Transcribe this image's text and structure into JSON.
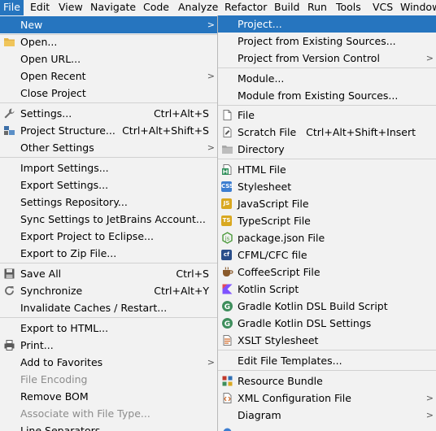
{
  "menubar": [
    "File",
    "Edit",
    "View",
    "Navigate",
    "Code",
    "Analyze",
    "Refactor",
    "Build",
    "Run",
    "Tools",
    "VCS",
    "Window"
  ],
  "file_menu": {
    "new": "New",
    "open": "Open...",
    "open_url": "Open URL...",
    "open_recent": "Open Recent",
    "close_project": "Close Project",
    "settings": "Settings...",
    "settings_sc": "Ctrl+Alt+S",
    "project_structure": "Project Structure...",
    "project_structure_sc": "Ctrl+Alt+Shift+S",
    "other_settings": "Other Settings",
    "import_settings": "Import Settings...",
    "export_settings": "Export Settings...",
    "settings_repository": "Settings Repository...",
    "sync_settings": "Sync Settings to JetBrains Account...",
    "export_eclipse": "Export Project to Eclipse...",
    "export_zip": "Export to Zip File...",
    "save_all": "Save All",
    "save_all_sc": "Ctrl+S",
    "synchronize": "Synchronize",
    "synchronize_sc": "Ctrl+Alt+Y",
    "invalidate_caches": "Invalidate Caches / Restart...",
    "export_html": "Export to HTML...",
    "print": "Print...",
    "add_favorites": "Add to Favorites",
    "file_encoding": "File Encoding",
    "remove_bom": "Remove BOM",
    "associate_file_type": "Associate with File Type...",
    "line_separators": "Line Separators"
  },
  "new_menu": {
    "project": "Project...",
    "project_existing": "Project from Existing Sources...",
    "project_vcs": "Project from Version Control",
    "module": "Module...",
    "module_existing": "Module from Existing Sources...",
    "file": "File",
    "scratch_file": "Scratch File",
    "scratch_file_sc": "Ctrl+Alt+Shift+Insert",
    "directory": "Directory",
    "html_file": "HTML File",
    "stylesheet": "Stylesheet",
    "javascript_file": "JavaScript File",
    "typescript_file": "TypeScript File",
    "package_json": "package.json File",
    "cfml_file": "CFML/CFC file",
    "coffeescript_file": "CoffeeScript File",
    "kotlin_script": "Kotlin Script",
    "gradle_build_script": "Gradle Kotlin DSL Build Script",
    "gradle_settings": "Gradle Kotlin DSL Settings",
    "xslt_stylesheet": "XSLT Stylesheet",
    "edit_templates": "Edit File Templates...",
    "resource_bundle": "Resource Bundle",
    "xml_configuration": "XML Configuration File",
    "diagram": "Diagram"
  },
  "icon_chips": {
    "css": "CSS",
    "js": "JS",
    "ts": "TS",
    "cf": "cf"
  }
}
